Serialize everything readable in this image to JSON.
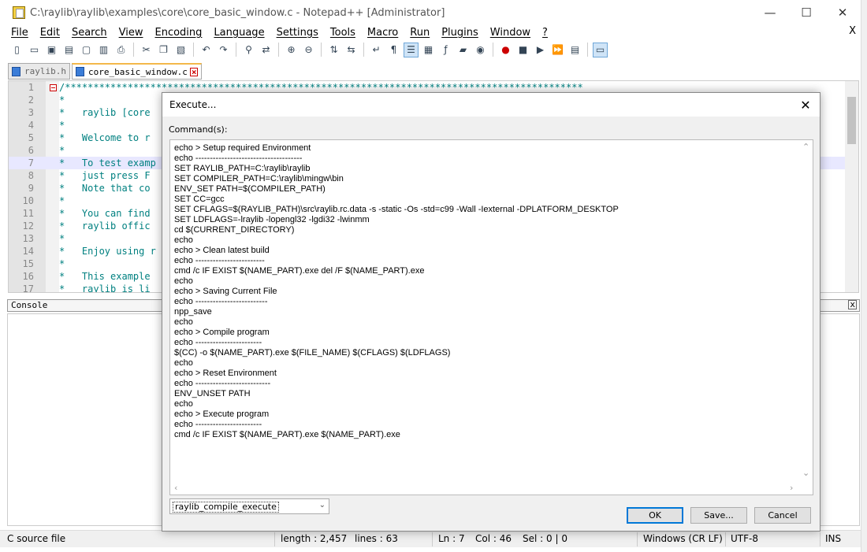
{
  "window": {
    "title": "C:\\raylib\\raylib\\examples\\core\\core_basic_window.c - Notepad++ [Administrator]",
    "minimize": "—",
    "maximize": "☐",
    "close": "✕"
  },
  "menu": {
    "items": [
      "File",
      "Edit",
      "Search",
      "View",
      "Encoding",
      "Language",
      "Settings",
      "Tools",
      "Macro",
      "Run",
      "Plugins",
      "Window",
      "?"
    ],
    "close": "X"
  },
  "toolbar": {
    "icons": [
      "new-file-icon",
      "open-file-icon",
      "save-icon",
      "save-all-icon",
      "close-icon",
      "close-all-icon",
      "print-icon",
      "cut-icon",
      "copy-icon",
      "paste-icon",
      "undo-icon",
      "redo-icon",
      "find-icon",
      "replace-icon",
      "zoom-in-icon",
      "zoom-out-icon",
      "sync-vertical-icon",
      "sync-horizontal-icon",
      "word-wrap-icon",
      "show-all-chars-icon",
      "indent-guide-icon",
      "doc-map-icon",
      "function-list-icon",
      "folder-workspace-icon",
      "monitoring-icon",
      "record-macro-icon",
      "stop-record-icon",
      "play-macro-icon",
      "run-macro-multiple-icon",
      "save-macro-icon",
      "console-icon"
    ]
  },
  "tabs": [
    {
      "label": "raylib.h",
      "active": false
    },
    {
      "label": "core_basic_window.c",
      "active": true
    }
  ],
  "editor": {
    "lines": [
      {
        "n": "1",
        "text": "/*******************************************************************************************"
      },
      {
        "n": "2",
        "text": "*"
      },
      {
        "n": "3",
        "text": "*   raylib [core"
      },
      {
        "n": "4",
        "text": "*"
      },
      {
        "n": "5",
        "text": "*   Welcome to r"
      },
      {
        "n": "6",
        "text": "*"
      },
      {
        "n": "7",
        "text": "*   To test examp"
      },
      {
        "n": "8",
        "text": "*   just press F"
      },
      {
        "n": "9",
        "text": "*   Note that co"
      },
      {
        "n": "10",
        "text": "*"
      },
      {
        "n": "11",
        "text": "*   You can find"
      },
      {
        "n": "12",
        "text": "*   raylib offic"
      },
      {
        "n": "13",
        "text": "*"
      },
      {
        "n": "14",
        "text": "*   Enjoy using r"
      },
      {
        "n": "15",
        "text": "*"
      },
      {
        "n": "16",
        "text": "*   This example"
      },
      {
        "n": "17",
        "text": "*   raylib is li"
      }
    ],
    "current_line": "7"
  },
  "console": {
    "title": "Console",
    "close": "x"
  },
  "status": {
    "filetype": "C source file",
    "length": "length : 2,457",
    "lines": "lines : 63",
    "ln": "Ln : 7",
    "col": "Col : 46",
    "sel": "Sel : 0 | 0",
    "eol": "Windows (CR LF)",
    "encoding": "UTF-8",
    "mode": "INS"
  },
  "dialog": {
    "title": "Execute...",
    "close": "✕",
    "label": "Command(s):",
    "commands": [
      "echo > Setup required Environment",
      "echo -------------------------------------",
      "SET RAYLIB_PATH=C:\\raylib\\raylib",
      "SET COMPILER_PATH=C:\\raylib\\mingw\\bin",
      "ENV_SET PATH=$(COMPILER_PATH)",
      "SET CC=gcc",
      "SET CFLAGS=$(RAYLIB_PATH)\\src\\raylib.rc.data -s -static -Os -std=c99 -Wall -Iexternal -DPLATFORM_DESKTOP",
      "SET LDFLAGS=-lraylib -lopengl32 -lgdi32 -lwinmm",
      "cd $(CURRENT_DIRECTORY)",
      "echo",
      "echo > Clean latest build",
      "echo ------------------------",
      "cmd /c IF EXIST $(NAME_PART).exe del /F $(NAME_PART).exe",
      "echo",
      "echo > Saving Current File",
      "echo -------------------------",
      "npp_save",
      "echo",
      "echo > Compile program",
      "echo -----------------------",
      "$(CC) -o $(NAME_PART).exe $(FILE_NAME) $(CFLAGS) $(LDFLAGS)",
      "echo",
      "echo > Reset Environment",
      "echo --------------------------",
      "ENV_UNSET PATH",
      "echo",
      "echo > Execute program",
      "echo -----------------------",
      "cmd /c IF EXIST $(NAME_PART).exe $(NAME_PART).exe"
    ],
    "selected_command": "raylib_compile_execute",
    "ok_label": "OK",
    "save_label": "Save...",
    "cancel_label": "Cancel"
  }
}
